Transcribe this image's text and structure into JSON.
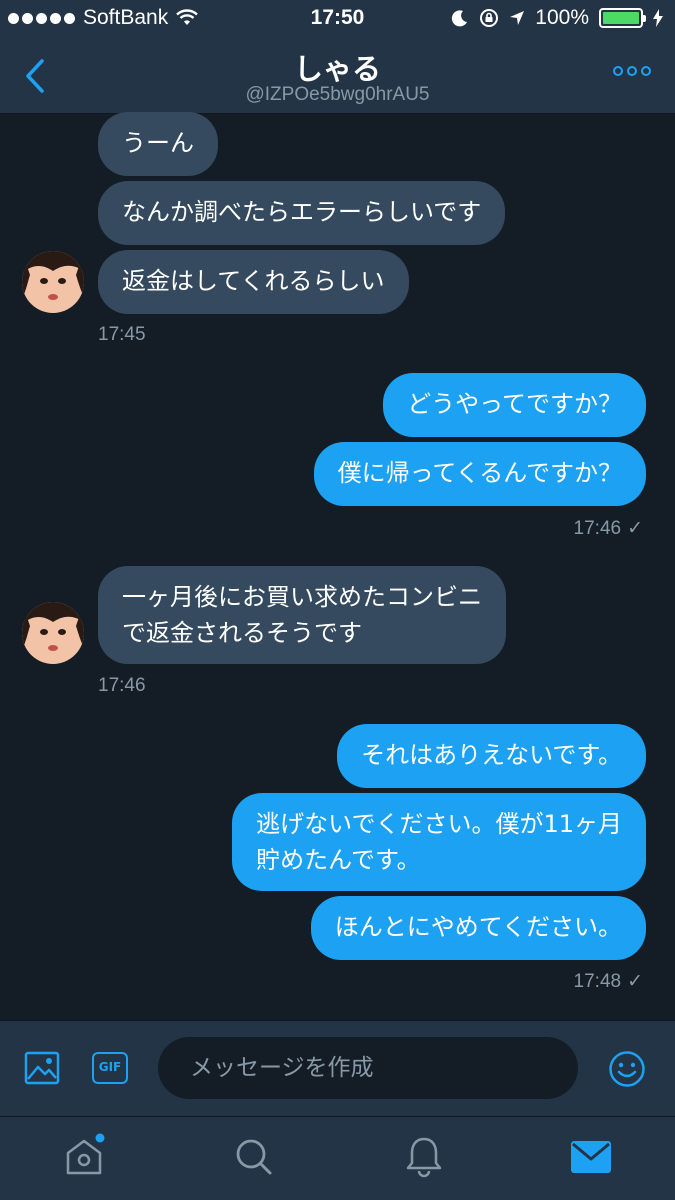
{
  "status": {
    "carrier": "SoftBank",
    "time": "17:50",
    "battery": "100%"
  },
  "header": {
    "name": "しゃる",
    "handle": "@IZPOe5bwg0hrAU5"
  },
  "messages": [
    {
      "text": "うーん"
    },
    {
      "text": "なんか調べたらエラーらしいです"
    },
    {
      "text": "返金はしてくれるらしい"
    },
    {
      "text": "どうやってですか？"
    },
    {
      "text": "僕に帰ってくるんですか？"
    },
    {
      "text": "一ヶ月後にお買い求めたコンビニ\nで返金されるそうです"
    },
    {
      "text": "それはありえないです。"
    },
    {
      "text": "逃げないでください。僕が11ヶ月\n貯めたんです。"
    },
    {
      "text": "ほんとにやめてください。"
    }
  ],
  "timestamps": [
    "17:45",
    "17:46",
    "17:46",
    "17:48"
  ],
  "composer": {
    "gif_label": "GIF",
    "placeholder": "メッセージを作成"
  },
  "icons": [
    "back-icon",
    "more-icon",
    "image-icon",
    "gif-icon",
    "emoji-icon",
    "home-icon",
    "search-icon",
    "bell-icon",
    "mail-icon"
  ],
  "colors": {
    "accent": "#1da1f2",
    "background": "#141d26",
    "bar": "#243447",
    "received_bubble": "#354a5f",
    "muted": "#8899a6"
  }
}
